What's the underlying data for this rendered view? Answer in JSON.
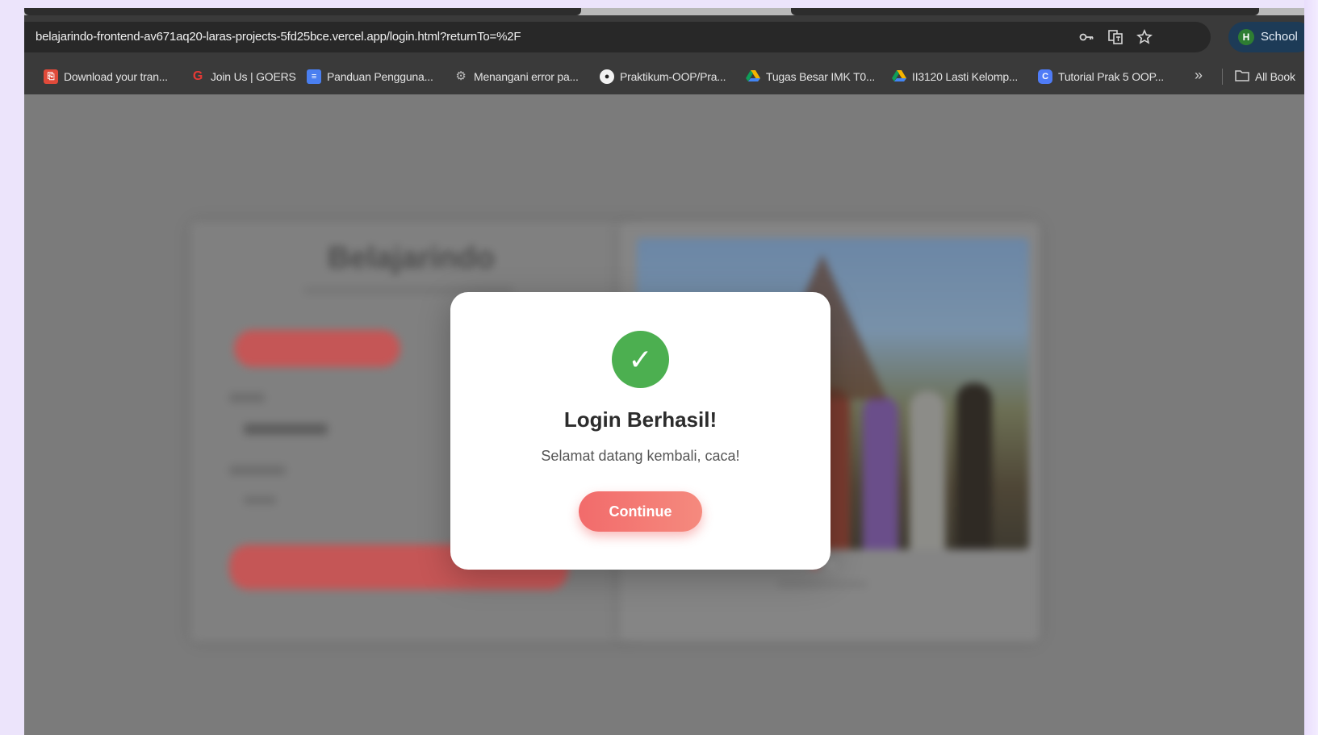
{
  "browser": {
    "url": "belajarindo-frontend-av671aq20-laras-projects-5fd25bce.vercel.app/login.html?returnTo=%2F",
    "profile_initial": "H",
    "profile_label": "School",
    "bookmarks": [
      {
        "label": "Download your tran...",
        "icon": "pdf-icon",
        "color": "#e04a3a"
      },
      {
        "label": "Join Us | GOERS",
        "icon": "goers-icon",
        "color": "#e53935"
      },
      {
        "label": "Panduan Pengguna...",
        "icon": "docs-icon",
        "color": "#4a7ff0"
      },
      {
        "label": "Menangani error pa...",
        "icon": "gear-icon",
        "color": "#9e9e9e"
      },
      {
        "label": "Praktikum-OOP/Pra...",
        "icon": "github-icon",
        "color": "#ffffff"
      },
      {
        "label": "Tugas Besar IMK T0...",
        "icon": "drive-icon",
        "color": "#f4b400"
      },
      {
        "label": "II3120 Lasti Kelomp...",
        "icon": "drive-icon",
        "color": "#f4b400"
      },
      {
        "label": "Tutorial Prak 5 OOP...",
        "icon": "canva-icon",
        "color": "#4f7cf7"
      }
    ],
    "all_bookmarks_label": "All Book"
  },
  "modal": {
    "icon": "check-icon",
    "title": "Login Berhasil!",
    "message": "Selamat datang kembali, caca!",
    "button_label": "Continue",
    "accent": "#f26b6b",
    "success_color": "#4caf50"
  },
  "background": {
    "brand": "Belajarindo"
  }
}
